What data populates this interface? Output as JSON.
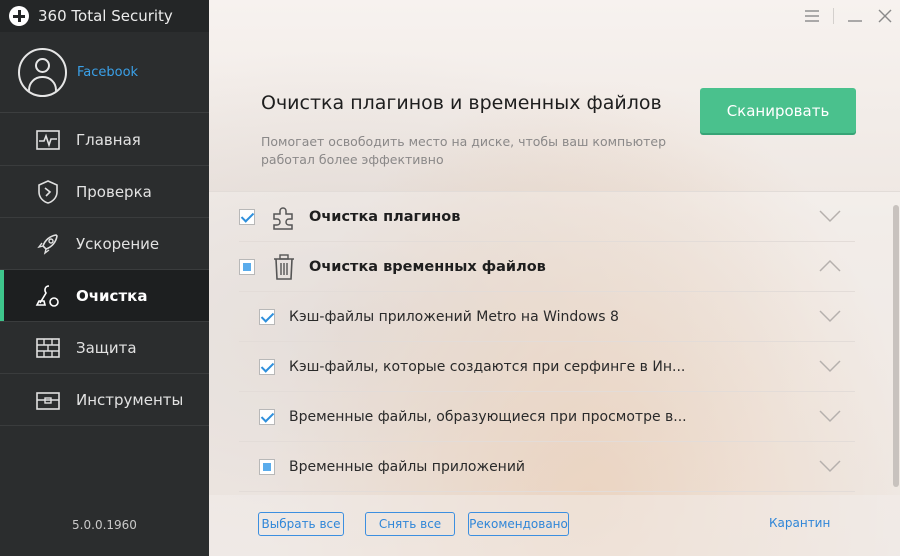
{
  "app": {
    "title": "360 Total Security",
    "version": "5.0.0.1960"
  },
  "profile": {
    "name": "Facebook"
  },
  "nav": {
    "items": [
      {
        "label": "Главная",
        "icon": "pulse-icon"
      },
      {
        "label": "Проверка",
        "icon": "shield-icon"
      },
      {
        "label": "Ускорение",
        "icon": "rocket-icon"
      },
      {
        "label": "Очистка",
        "icon": "vacuum-icon",
        "active": true
      },
      {
        "label": "Защита",
        "icon": "firewall-icon"
      },
      {
        "label": "Инструменты",
        "icon": "toolbox-icon"
      }
    ]
  },
  "header": {
    "title": "Очистка плагинов и временных файлов",
    "description": "Помогает освободить место на диске, чтобы ваш компьютер работал более эффективно",
    "scan_label": "Сканировать"
  },
  "list": {
    "items": [
      {
        "label": "Очистка плагинов",
        "state": "checked",
        "level": "category",
        "icon": "puzzle-icon",
        "expanded": false
      },
      {
        "label": "Очистка временных файлов",
        "state": "partial",
        "level": "category",
        "icon": "trash-icon",
        "expanded": true
      },
      {
        "label": "Кэш-файлы приложений Metro на Windows 8",
        "state": "checked",
        "level": "sub"
      },
      {
        "label": "Кэш-файлы, которые создаются при серфинге в Ин...",
        "state": "checked",
        "level": "sub"
      },
      {
        "label": "Временные файлы, образующиеся при просмотре в...",
        "state": "checked",
        "level": "sub"
      },
      {
        "label": "Временные файлы приложений",
        "state": "partial",
        "level": "sub"
      }
    ]
  },
  "footer": {
    "select_all": "Выбрать все",
    "deselect_all": "Снять все",
    "recommended": "Рекомендовано",
    "quarantine": "Карантин"
  },
  "colors": {
    "accent": "#4ac18d",
    "link": "#2f86d8",
    "sidebar": "#2b2d2e",
    "active_marker": "#3ec58c"
  }
}
